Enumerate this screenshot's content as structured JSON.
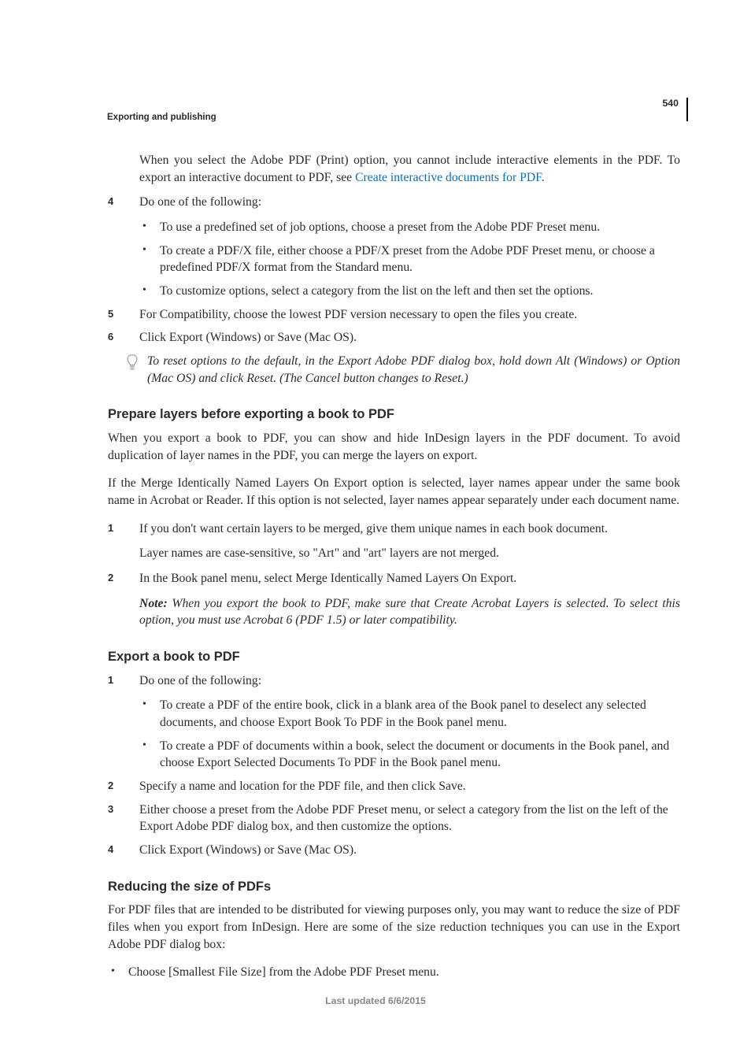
{
  "page_number": "540",
  "header": "Exporting and publishing",
  "intro_para": {
    "prefix": "When you select the Adobe PDF (Print) option, you cannot include interactive elements in the PDF. To export an interactive document to PDF, see ",
    "link_text": "Create interactive documents for PDF",
    "suffix": "."
  },
  "s1": {
    "step4": {
      "lead": "Do one of the following:",
      "bullets": [
        "To use a predefined set of job options, choose a preset from the Adobe PDF Preset menu.",
        "To create a PDF/X file, either choose a PDF/X preset from the Adobe PDF Preset menu, or choose a predefined PDF/X format from the Standard menu.",
        "To customize options, select a category from the list on the left and then set the options."
      ]
    },
    "step5": "For Compatibility, choose the lowest PDF version necessary to open the files you create.",
    "step6": "Click Export (Windows) or Save (Mac OS).",
    "tip": "To reset options to the default, in the Export Adobe PDF dialog box, hold down Alt (Windows) or Option (Mac OS) and click Reset. (The Cancel button changes to Reset.)"
  },
  "s2": {
    "title": "Prepare layers before exporting a book to PDF",
    "p1": "When you export a book to PDF, you can show and hide InDesign layers in the PDF document. To avoid duplication of layer names in the PDF, you can merge the layers on export.",
    "p2": "If the Merge Identically Named Layers On Export option is selected, layer names appear under the same book name in Acrobat or Reader. If this option is not selected, layer names appear separately under each document name.",
    "step1": {
      "lead": "If you don't want certain layers to be merged, give them unique names in each book document.",
      "sub": "Layer names are case-sensitive, so \"Art\" and \"art\" layers are not merged."
    },
    "step2": {
      "lead": "In the Book panel menu, select Merge Identically Named Layers On Export.",
      "note_label": "Note: ",
      "note": "When you export the book to PDF, make sure that Create Acrobat Layers is selected. To select this option, you must use Acrobat 6 (PDF 1.5) or later compatibility."
    }
  },
  "s3": {
    "title": "Export a book to PDF",
    "step1": {
      "lead": "Do one of the following:",
      "bullets": [
        "To create a PDF of the entire book, click in a blank area of the Book panel to deselect any selected documents, and choose Export Book To PDF in the Book panel menu.",
        "To create a PDF of documents within a book, select the document or documents in the Book panel, and choose Export Selected Documents To PDF in the Book panel menu."
      ]
    },
    "step2": "Specify a name and location for the PDF file, and then click Save.",
    "step3": "Either choose a preset from the Adobe PDF Preset menu, or select a category from the list on the left of the Export Adobe PDF dialog box, and then customize the options.",
    "step4": "Click Export (Windows) or Save (Mac OS)."
  },
  "s4": {
    "title": "Reducing the size of PDFs",
    "p1": "For PDF files that are intended to be distributed for viewing purposes only, you may want to reduce the size of PDF files when you export from InDesign. Here are some of the size reduction techniques you can use in the Export Adobe PDF dialog box:",
    "bullet": "Choose [Smallest File Size] from the Adobe PDF Preset menu."
  },
  "footer": "Last updated 6/6/2015"
}
